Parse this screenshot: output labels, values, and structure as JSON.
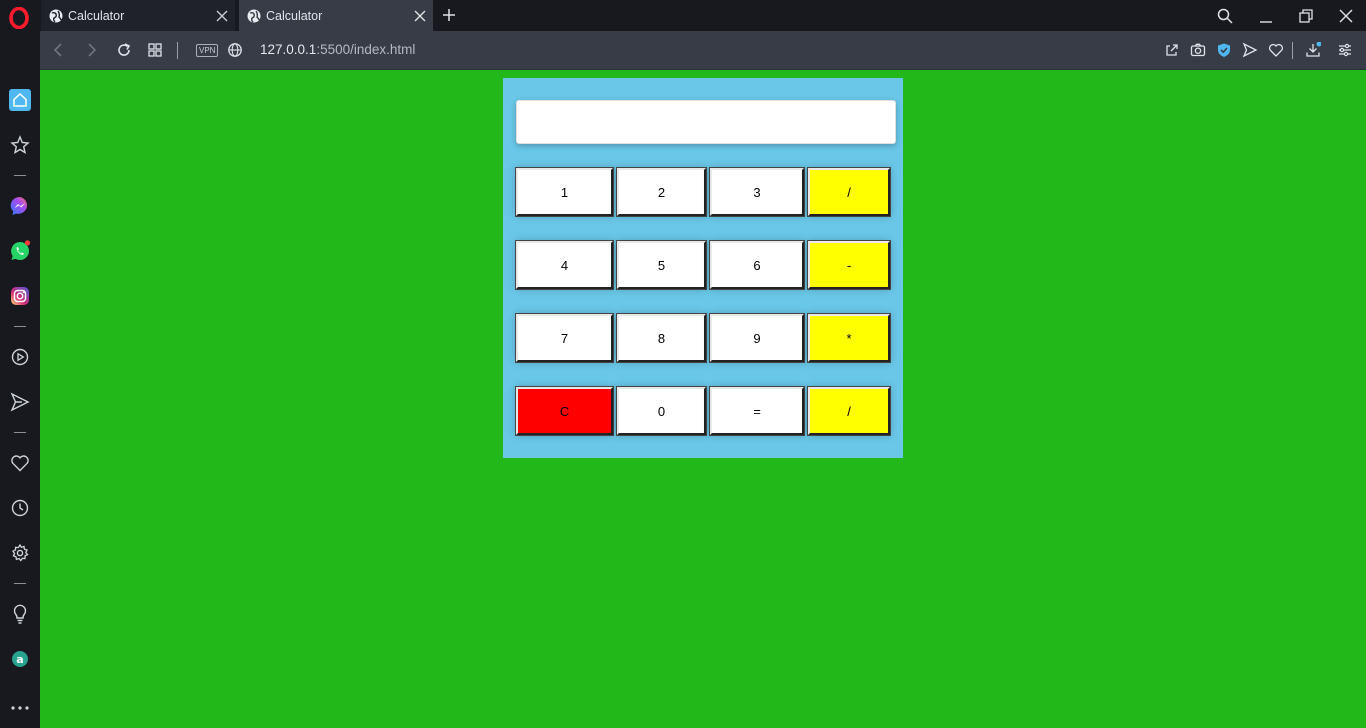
{
  "browser": {
    "tabs": [
      {
        "title": "Calculator",
        "active": false
      },
      {
        "title": "Calculator",
        "active": true
      }
    ],
    "vpn_label": "VPN",
    "url_host": "127.0.0.1",
    "url_path": ":5500/index.html",
    "colors": {
      "chrome": "#17191e",
      "toolbar": "#373c46",
      "accent": "#4fb8f0"
    },
    "toolbar_icons": [
      "back-icon",
      "forward-icon",
      "reload-icon",
      "tab-grid-icon",
      "globe-icon",
      "share-icon",
      "camera-icon",
      "shield-icon",
      "send-icon",
      "heart-icon",
      "download-icon",
      "easy-setup-icon"
    ],
    "sidebar_icons": [
      "home-icon",
      "star-icon",
      "messenger-icon",
      "whatsapp-icon",
      "instagram-icon",
      "player-icon",
      "send-icon",
      "heart-icon",
      "history-icon",
      "settings-icon",
      "lightbulb-icon",
      "aria-icon",
      "more-icon"
    ]
  },
  "calculator": {
    "display_value": "",
    "colors": {
      "page_background": "#22b81a",
      "panel": "#6ac7e8",
      "number_key": "#ffffff",
      "operator_key": "#ffff00",
      "clear_key": "#ff0000"
    },
    "keys": {
      "k1": "1",
      "k2": "2",
      "k3": "3",
      "div1": "/",
      "k4": "4",
      "k5": "5",
      "k6": "6",
      "minus": "-",
      "k7": "7",
      "k8": "8",
      "k9": "9",
      "mult": "*",
      "clear": "C",
      "k0": "0",
      "equals": "=",
      "div2": "/"
    }
  }
}
